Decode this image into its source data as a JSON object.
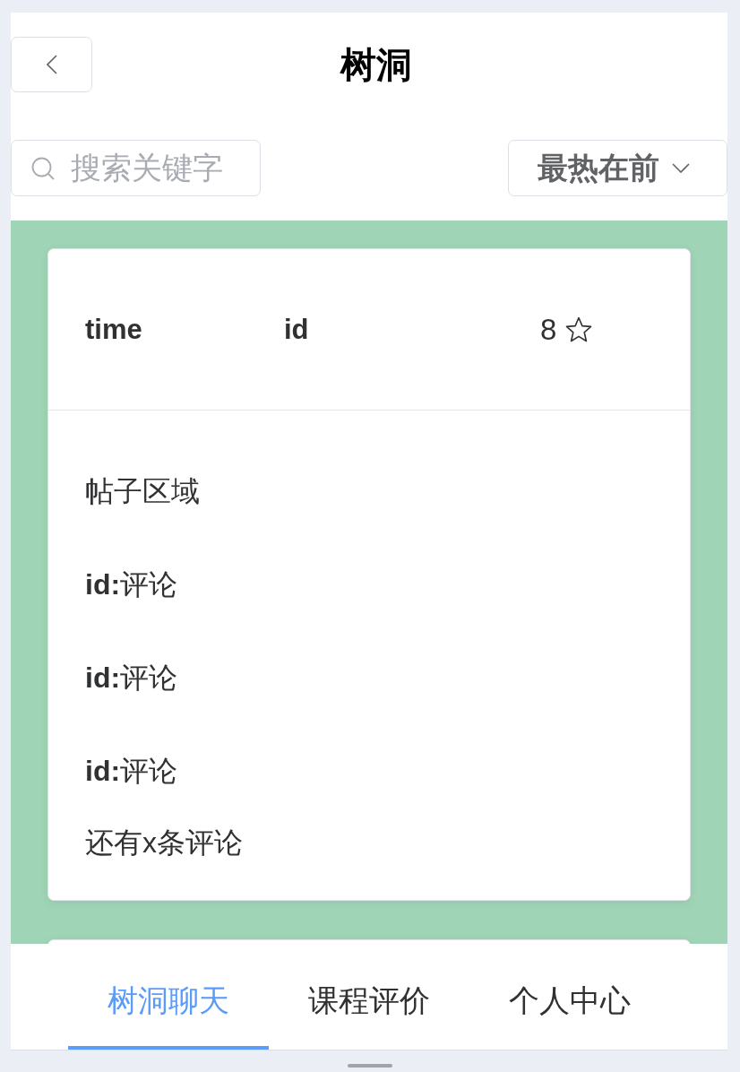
{
  "header": {
    "title": "树洞"
  },
  "search": {
    "placeholder": "搜索关键字"
  },
  "sort": {
    "value": "最热在前"
  },
  "posts": [
    {
      "time": "time",
      "id": "id",
      "likes": "8",
      "starred": false,
      "body": "帖子区域",
      "comments": [
        "**id:**评论",
        "**id:**评论",
        "**id:**评论"
      ],
      "more": "还有x条评论"
    }
  ],
  "tabs": [
    {
      "label": "树洞聊天",
      "selected": true
    },
    {
      "label": "课程评价",
      "selected": false
    },
    {
      "label": "个人中心",
      "selected": false
    }
  ]
}
